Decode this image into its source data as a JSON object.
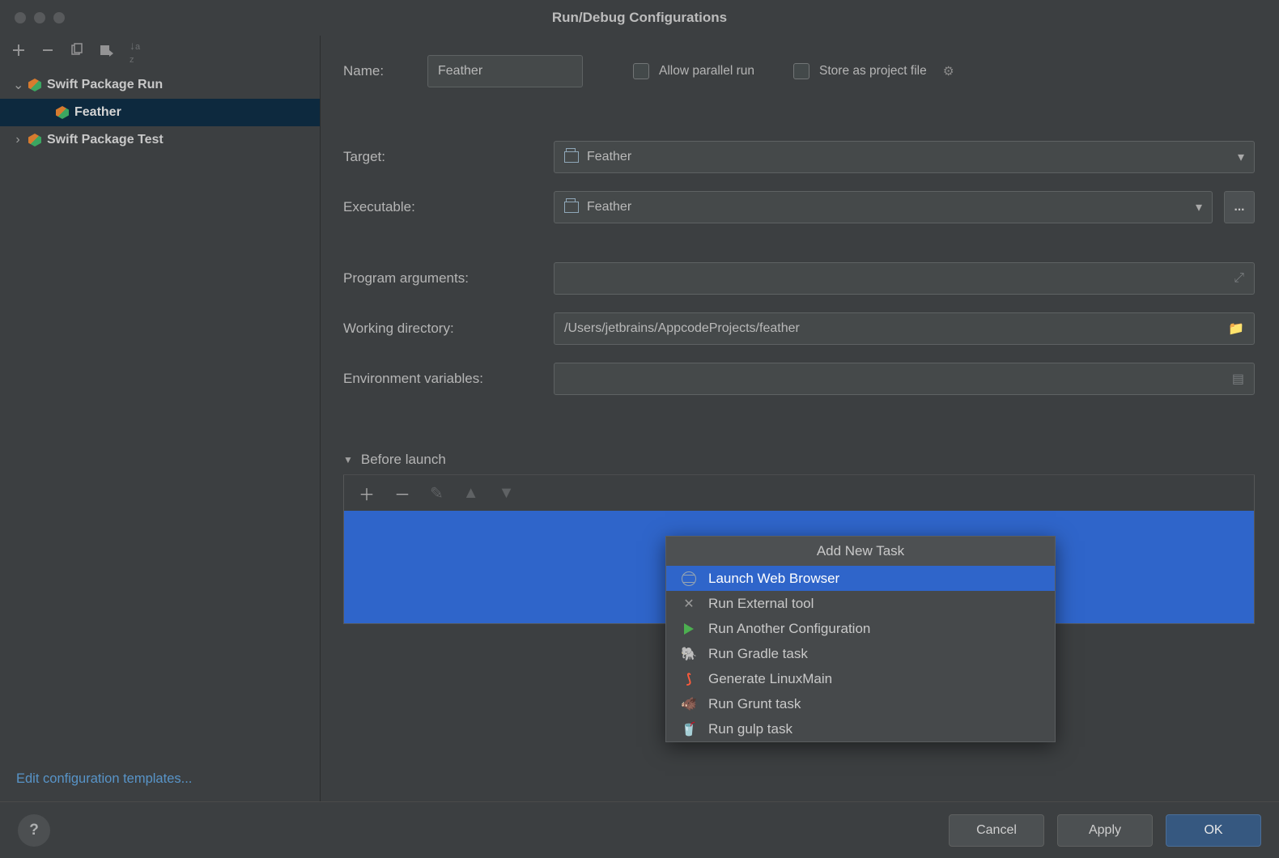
{
  "title": "Run/Debug Configurations",
  "sidebar": {
    "items": [
      {
        "label": "Swift Package Run",
        "expanded": true,
        "children": [
          {
            "label": "Feather"
          }
        ]
      },
      {
        "label": "Swift Package Test",
        "expanded": false
      }
    ]
  },
  "edit_templates": "Edit configuration templates...",
  "form": {
    "name_label": "Name:",
    "name_value": "Feather",
    "allow_parallel": "Allow parallel run",
    "store_project": "Store as project file",
    "target_label": "Target:",
    "target_value": "Feather",
    "executable_label": "Executable:",
    "executable_value": "Feather",
    "browse_button": "...",
    "program_args_label": "Program arguments:",
    "program_args_value": "",
    "working_dir_label": "Working directory:",
    "working_dir_value": "/Users/jetbrains/AppcodeProjects/feather",
    "env_label": "Environment variables:",
    "env_value": ""
  },
  "before_launch": {
    "title": "Before launch"
  },
  "popup": {
    "title": "Add New Task",
    "items": [
      "Launch Web Browser",
      "Run External tool",
      "Run Another Configuration",
      "Run Gradle task",
      "Generate LinuxMain",
      "Run Grunt task",
      "Run gulp task"
    ]
  },
  "buttons": {
    "cancel": "Cancel",
    "apply": "Apply",
    "ok": "OK"
  }
}
